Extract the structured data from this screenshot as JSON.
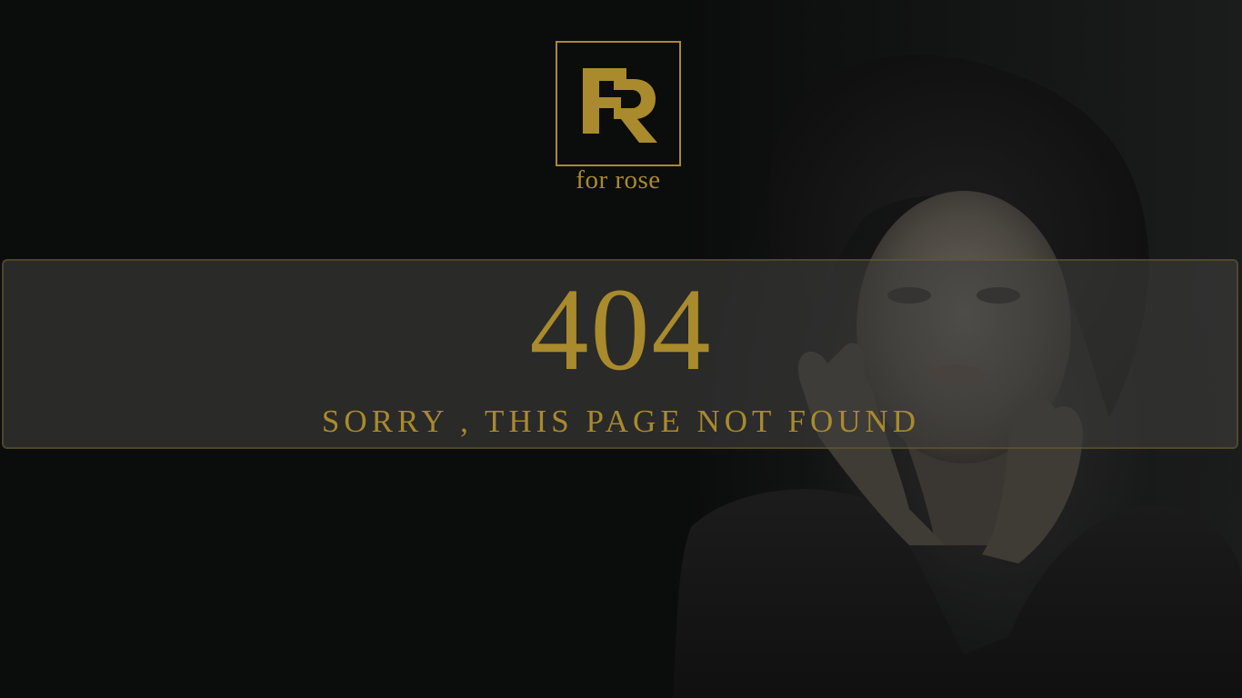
{
  "brand": {
    "name": "for rose",
    "accent_color": "#a98a2c"
  },
  "error": {
    "code": "404",
    "message": "SORRY , THIS PAGE NOT FOUND"
  },
  "background": {
    "image": "portrait of a woman with dark hair and hand near face"
  }
}
